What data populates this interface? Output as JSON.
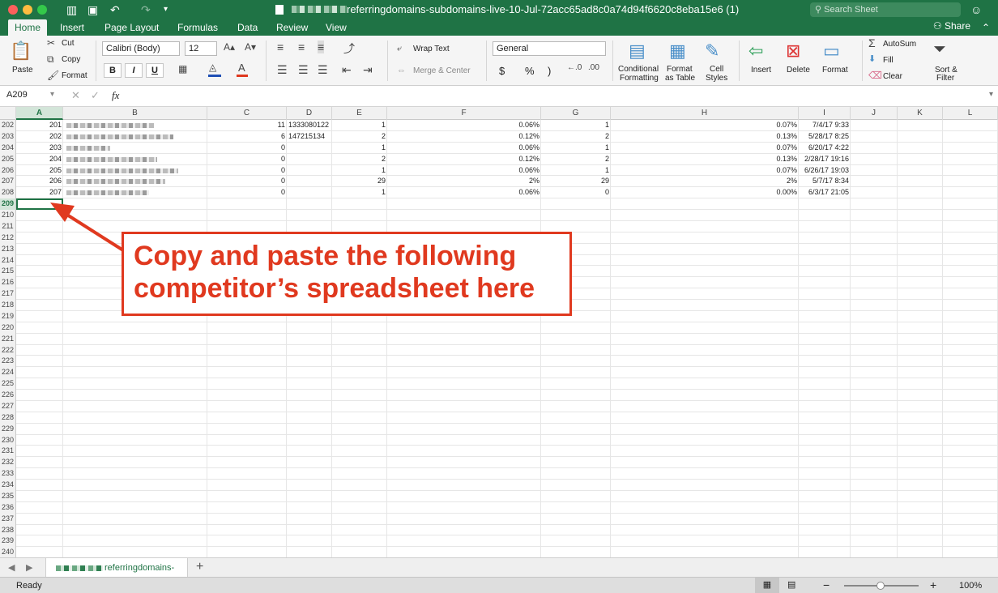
{
  "window": {
    "title": "referringdomains-subdomains-live-10-Jul-72acc65ad8c0a74d94f6620c8eba15e6 (1)",
    "search_placeholder": "Search Sheet"
  },
  "tabs": [
    "Home",
    "Insert",
    "Page Layout",
    "Formulas",
    "Data",
    "Review",
    "View"
  ],
  "share_label": "Share",
  "ribbon": {
    "paste": "Paste",
    "cut": "Cut",
    "copy": "Copy",
    "format": "Format",
    "font_name": "Calibri (Body)",
    "font_size": "12",
    "bold": "B",
    "italic": "I",
    "underline": "U",
    "wrap_text": "Wrap Text",
    "merge_center": "Merge & Center",
    "number_format": "General",
    "currency": "$",
    "percent": "%",
    "comma": ")",
    "conditional_1": "Conditional",
    "conditional_2": "Formatting",
    "format_table_1": "Format",
    "format_table_2": "as Table",
    "cell_styles_1": "Cell",
    "cell_styles_2": "Styles",
    "insert": "Insert",
    "delete": "Delete",
    "format_cells": "Format",
    "autosum": "AutoSum",
    "fill": "Fill",
    "clear": "Clear",
    "sort_1": "Sort &",
    "sort_2": "Filter"
  },
  "formula_bar": {
    "name_box": "A209",
    "fx": "fx",
    "value": ""
  },
  "columns": [
    "A",
    "B",
    "C",
    "D",
    "E",
    "F",
    "G",
    "H",
    "I",
    "J",
    "K",
    "L"
  ],
  "data_rows": [
    {
      "row": "202",
      "a": "201",
      "c": "11",
      "d": "1333080122",
      "e": "1",
      "f": "0.06%",
      "g": "1",
      "h": "0.07%",
      "i": "7/4/17 9:33"
    },
    {
      "row": "203",
      "a": "202",
      "c": "6",
      "d": "147215134",
      "e": "2",
      "f": "0.12%",
      "g": "2",
      "h": "0.13%",
      "i": "5/28/17 8:25"
    },
    {
      "row": "204",
      "a": "203",
      "c": "0",
      "d": "",
      "e": "1",
      "f": "0.06%",
      "g": "1",
      "h": "0.07%",
      "i": "6/20/17 4:22"
    },
    {
      "row": "205",
      "a": "204",
      "c": "0",
      "d": "",
      "e": "2",
      "f": "0.12%",
      "g": "2",
      "h": "0.13%",
      "i": "2/28/17 19:16"
    },
    {
      "row": "206",
      "a": "205",
      "c": "0",
      "d": "",
      "e": "1",
      "f": "0.06%",
      "g": "1",
      "h": "0.07%",
      "i": "6/26/17 19:03"
    },
    {
      "row": "207",
      "a": "206",
      "c": "0",
      "d": "",
      "e": "29",
      "f": "2%",
      "g": "29",
      "h": "2%",
      "i": "5/7/17 8:34"
    },
    {
      "row": "208",
      "a": "207",
      "c": "0",
      "d": "",
      "e": "1",
      "f": "0.06%",
      "g": "0",
      "h": "0.00%",
      "i": "6/3/17 21:05"
    }
  ],
  "empty_rows": [
    "209",
    "210",
    "211",
    "212",
    "213",
    "214",
    "215",
    "216",
    "217",
    "218",
    "219",
    "220",
    "221",
    "222",
    "223",
    "224",
    "225",
    "226",
    "227",
    "228",
    "229",
    "230",
    "231",
    "232",
    "233",
    "234",
    "235",
    "236",
    "237",
    "238",
    "239",
    "240"
  ],
  "callout": {
    "line1": "Copy and paste the following",
    "line2": "competitor’s spreadsheet here",
    "color": "#e0391f"
  },
  "sheet_tab": "referringdomains-",
  "status": {
    "ready": "Ready",
    "zoom": "100%"
  }
}
